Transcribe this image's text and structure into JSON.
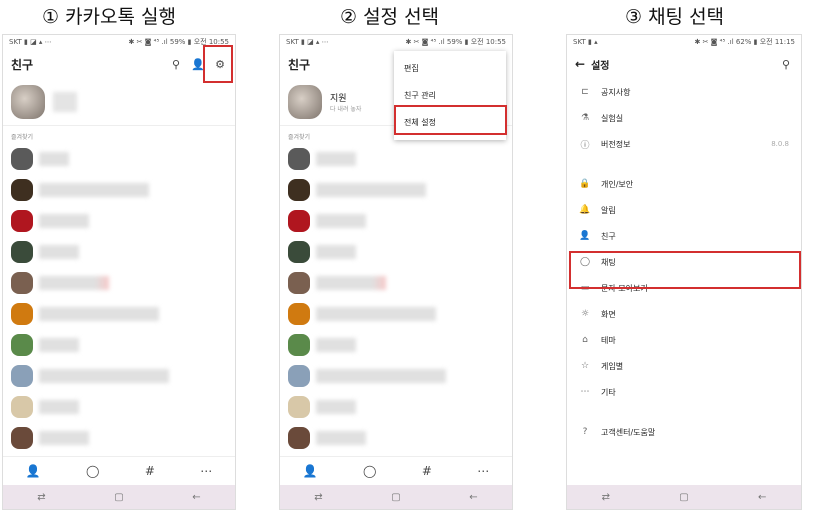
{
  "steps": [
    {
      "title": "① 카카오톡 실행"
    },
    {
      "title": "② 설정 선택"
    },
    {
      "title": "③ 채팅 선택"
    }
  ],
  "status_bars": [
    {
      "left": "SKT ▮ ◪ ▴ ⋯",
      "right": "✱ ✂ ◙ ⁴⁵ .ıl 59% ▮ 오전 10:55"
    },
    {
      "left": "SKT ▮ ◪ ▴ ⋯",
      "right": "✱ ✂ ◙ ⁴⁵ .ıl 59% ▮ 오전 10:55"
    },
    {
      "left": "SKT ▮ ▴",
      "right": "✱ ✂ ◙ ⁴⁵ .ıl 62% ▮ 오전 11:15"
    }
  ],
  "friends": {
    "title": "친구",
    "favorites_label": "즐겨찾기",
    "profile_name": "지원",
    "profile_status": "다 내려 놓자"
  },
  "menu": {
    "items": [
      "편집",
      "친구 관리",
      "전체 설정"
    ]
  },
  "settings": {
    "title": "설정",
    "items": [
      {
        "icon": "⊏",
        "label": "공지사항",
        "value": ""
      },
      {
        "icon": "⚗",
        "label": "실험실",
        "value": ""
      },
      {
        "icon": "ⓘ",
        "label": "버전정보",
        "value": "8.0.8"
      },
      {
        "icon": "🔒",
        "label": "개인/보안",
        "value": ""
      },
      {
        "icon": "🔔",
        "label": "알림",
        "value": ""
      },
      {
        "icon": "👤",
        "label": "친구",
        "value": ""
      },
      {
        "icon": "◯",
        "label": "채팅",
        "value": ""
      },
      {
        "icon": "▭",
        "label": "문자 모아보기",
        "value": ""
      },
      {
        "icon": "☼",
        "label": "화면",
        "value": ""
      },
      {
        "icon": "⌂",
        "label": "테마",
        "value": ""
      },
      {
        "icon": "☆",
        "label": "게임별",
        "value": ""
      },
      {
        "icon": "⋯",
        "label": "기타",
        "value": ""
      },
      {
        "icon": "?",
        "label": "고객센터/도움말",
        "value": ""
      }
    ]
  },
  "nav": {
    "friends": "👤",
    "chat": "◯",
    "hash": "#",
    "more": "⋯"
  },
  "sysnav": {
    "recent": "⇄",
    "home": "▢",
    "back": "←"
  },
  "colors": {
    "highlight": "#d32f2f",
    "sysbar": "#ede4ec"
  }
}
